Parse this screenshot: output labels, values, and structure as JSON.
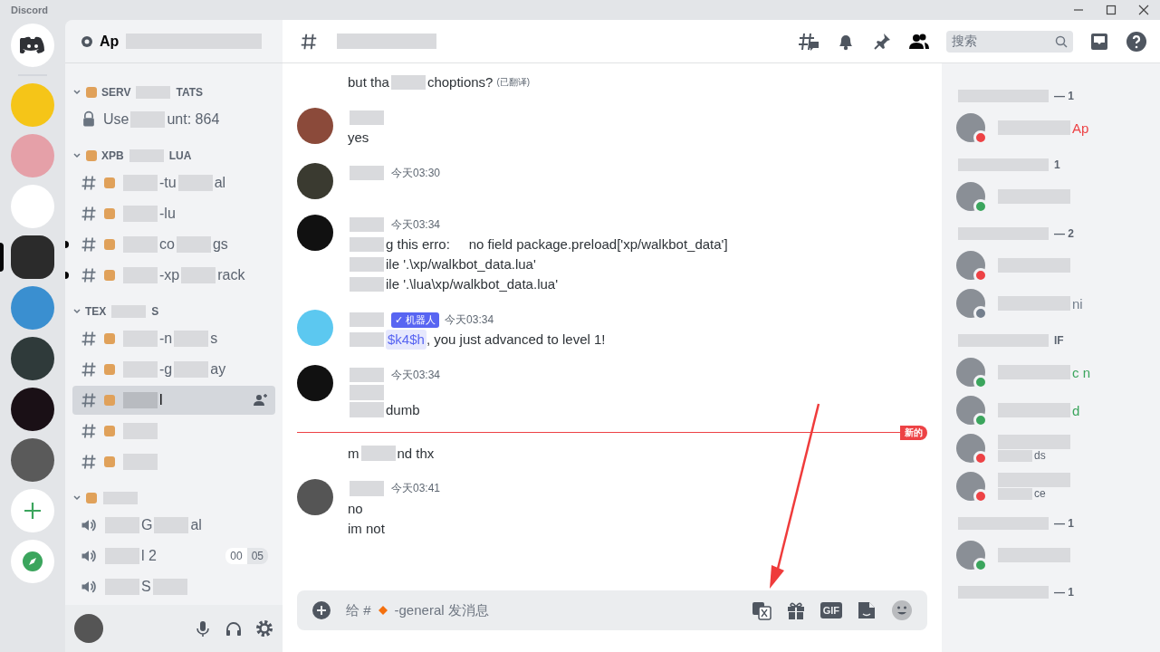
{
  "window": {
    "title": "Discord"
  },
  "servers": [
    {
      "selected": false
    },
    {
      "selected": false
    },
    {
      "selected": false
    },
    {
      "selected": true
    },
    {
      "selected": false
    },
    {
      "selected": false
    },
    {
      "selected": false
    },
    {
      "selected": false
    }
  ],
  "guild": {
    "name": "Ap"
  },
  "channels": [
    {
      "kind": "category",
      "name": [
        {
          "kind": "text",
          "text": "SERV"
        },
        {
          "kind": "mask"
        },
        {
          "kind": "text",
          "text": "TATS"
        }
      ],
      "emoji": true
    },
    {
      "kind": "locked",
      "name": [
        {
          "kind": "text",
          "text": "Use"
        },
        {
          "kind": "mask"
        },
        {
          "kind": "text",
          "text": "unt: 864"
        }
      ],
      "emoji": false,
      "unread": false,
      "selected": false
    },
    {
      "kind": "category",
      "name": [
        {
          "kind": "text",
          "text": "XPB"
        },
        {
          "kind": "mask"
        },
        {
          "kind": "text",
          "text": "LUA"
        }
      ],
      "emoji": true
    },
    {
      "kind": "text",
      "name": [
        {
          "kind": "mask"
        },
        {
          "kind": "text",
          "text": "-tu"
        },
        {
          "kind": "mask"
        },
        {
          "kind": "text",
          "text": "al"
        }
      ],
      "emoji": true,
      "unread": false,
      "selected": false
    },
    {
      "kind": "text",
      "name": [
        {
          "kind": "mask"
        },
        {
          "kind": "text",
          "text": "-lu"
        }
      ],
      "emoji": true,
      "unread": false,
      "selected": false
    },
    {
      "kind": "text",
      "name": [
        {
          "kind": "mask"
        },
        {
          "kind": "text",
          "text": "co"
        },
        {
          "kind": "mask"
        },
        {
          "kind": "text",
          "text": "gs"
        }
      ],
      "emoji": true,
      "unread": true,
      "selected": false
    },
    {
      "kind": "text",
      "name": [
        {
          "kind": "mask"
        },
        {
          "kind": "text",
          "text": "-xp"
        },
        {
          "kind": "mask"
        },
        {
          "kind": "text",
          "text": "rack"
        }
      ],
      "emoji": true,
      "unread": true,
      "selected": false
    },
    {
      "kind": "category",
      "name": [
        {
          "kind": "text",
          "text": "TEX"
        },
        {
          "kind": "mask"
        },
        {
          "kind": "text",
          "text": "S"
        }
      ],
      "emoji": false
    },
    {
      "kind": "text",
      "name": [
        {
          "kind": "mask"
        },
        {
          "kind": "text",
          "text": "-n"
        },
        {
          "kind": "mask"
        },
        {
          "kind": "text",
          "text": "s"
        }
      ],
      "emoji": true,
      "unread": false,
      "selected": false
    },
    {
      "kind": "text",
      "name": [
        {
          "kind": "mask"
        },
        {
          "kind": "text",
          "text": "-g"
        },
        {
          "kind": "mask"
        },
        {
          "kind": "text",
          "text": "ay"
        }
      ],
      "emoji": true,
      "unread": false,
      "selected": false
    },
    {
      "kind": "text",
      "name": [
        {
          "kind": "mask"
        },
        {
          "kind": "text",
          "text": "l"
        }
      ],
      "emoji": true,
      "unread": false,
      "selected": true
    },
    {
      "kind": "text",
      "name": [
        {
          "kind": "mask"
        }
      ],
      "emoji": true,
      "unread": false,
      "selected": false
    },
    {
      "kind": "text",
      "name": [
        {
          "kind": "mask"
        }
      ],
      "emoji": true,
      "unread": false,
      "selected": false
    },
    {
      "kind": "category",
      "name": [
        {
          "kind": "mask"
        }
      ],
      "emoji": true
    },
    {
      "kind": "voice",
      "name": [
        {
          "kind": "mask"
        },
        {
          "kind": "text",
          "text": "G"
        },
        {
          "kind": "mask"
        },
        {
          "kind": "text",
          "text": "al"
        }
      ],
      "emoji": false,
      "unread": false,
      "selected": false
    },
    {
      "kind": "voice",
      "name": [
        {
          "kind": "mask"
        },
        {
          "kind": "text",
          "text": "l 2"
        }
      ],
      "emoji": false,
      "unread": false,
      "selected": false,
      "users": "00",
      "limit": "05"
    },
    {
      "kind": "voice",
      "name": [
        {
          "kind": "mask"
        },
        {
          "kind": "text",
          "text": "S"
        },
        {
          "kind": "mask"
        }
      ],
      "emoji": false,
      "unread": false,
      "selected": false
    }
  ],
  "chat": {
    "search": {
      "placeholder": "搜索"
    },
    "messages": [
      {
        "kind": "continued",
        "lines": [
          [
            {
              "kind": "text",
              "text": "but tha"
            },
            {
              "kind": "mask"
            },
            {
              "kind": "text",
              "text": "choptions?"
            },
            {
              "kind": "note",
              "text": "(已翻译)"
            }
          ]
        ]
      },
      {
        "kind": "full",
        "lines": [
          [
            {
              "kind": "text",
              "text": "yes"
            }
          ]
        ]
      },
      {
        "kind": "full",
        "time": "今天03:30"
      },
      {
        "kind": "full",
        "time": "今天03:34",
        "lines": [
          [
            {
              "kind": "mask"
            },
            {
              "kind": "text",
              "text": "g this erro:     no field package.preload['xp/walkbot_data']"
            }
          ],
          [
            {
              "kind": "mask"
            },
            {
              "kind": "text",
              "text": "ile '.\\xp/walkbot_data.lua'"
            }
          ],
          [
            {
              "kind": "mask"
            },
            {
              "kind": "text",
              "text": "ile '.\\lua\\xp/walkbot_data.lua'"
            }
          ]
        ]
      },
      {
        "kind": "bot",
        "badge": "✓ 机器人",
        "time": "今天03:34",
        "lines": [
          [
            {
              "kind": "mask"
            },
            {
              "kind": "mention",
              "text": "$k4$h"
            },
            {
              "kind": "text",
              "text": ", you just advanced to level 1!"
            }
          ]
        ]
      },
      {
        "kind": "full",
        "time": "今天03:34",
        "lines": [
          [
            {
              "kind": "mask"
            }
          ],
          [
            {
              "kind": "mask"
            },
            {
              "kind": "text",
              "text": "dumb"
            }
          ]
        ]
      },
      {
        "kind": "divider",
        "label": "新的"
      },
      {
        "kind": "continued",
        "lines": [
          [
            {
              "kind": "text",
              "text": "m"
            },
            {
              "kind": "mask"
            },
            {
              "kind": "text",
              "text": "nd thx"
            }
          ]
        ]
      },
      {
        "kind": "full",
        "time": "今天03:41",
        "lines": [
          [
            {
              "kind": "text",
              "text": "no"
            }
          ],
          [
            {
              "kind": "text",
              "text": "im not"
            }
          ]
        ]
      }
    ],
    "composer": {
      "placeholder_start": "给 #",
      "placeholder_end": "-general 发消息",
      "gif": "GIF"
    }
  },
  "members": [
    {
      "count": "— 1",
      "members": [
        {
          "name": "Ap",
          "color": "#ed4245"
        }
      ]
    },
    {
      "count": "1",
      "members": [
        {
          "color": "#3ba55d"
        }
      ]
    },
    {
      "count": "— 2",
      "members": [
        {
          "color": "#ed4245"
        },
        {
          "name": "ni",
          "color": "#747f8d"
        }
      ]
    },
    {
      "count": "IF",
      "members": [
        {
          "name": "c n",
          "color": "#3ba55d"
        },
        {
          "name": "d",
          "color": "#3ba55d"
        },
        {
          "activity": "ds",
          "color": "#ed4245"
        },
        {
          "activity": "ce",
          "color": "#ed4245"
        }
      ]
    },
    {
      "count": "— 1",
      "members": [
        {
          "color": "#3ba55d"
        }
      ]
    },
    {
      "count": "— 1"
    }
  ]
}
